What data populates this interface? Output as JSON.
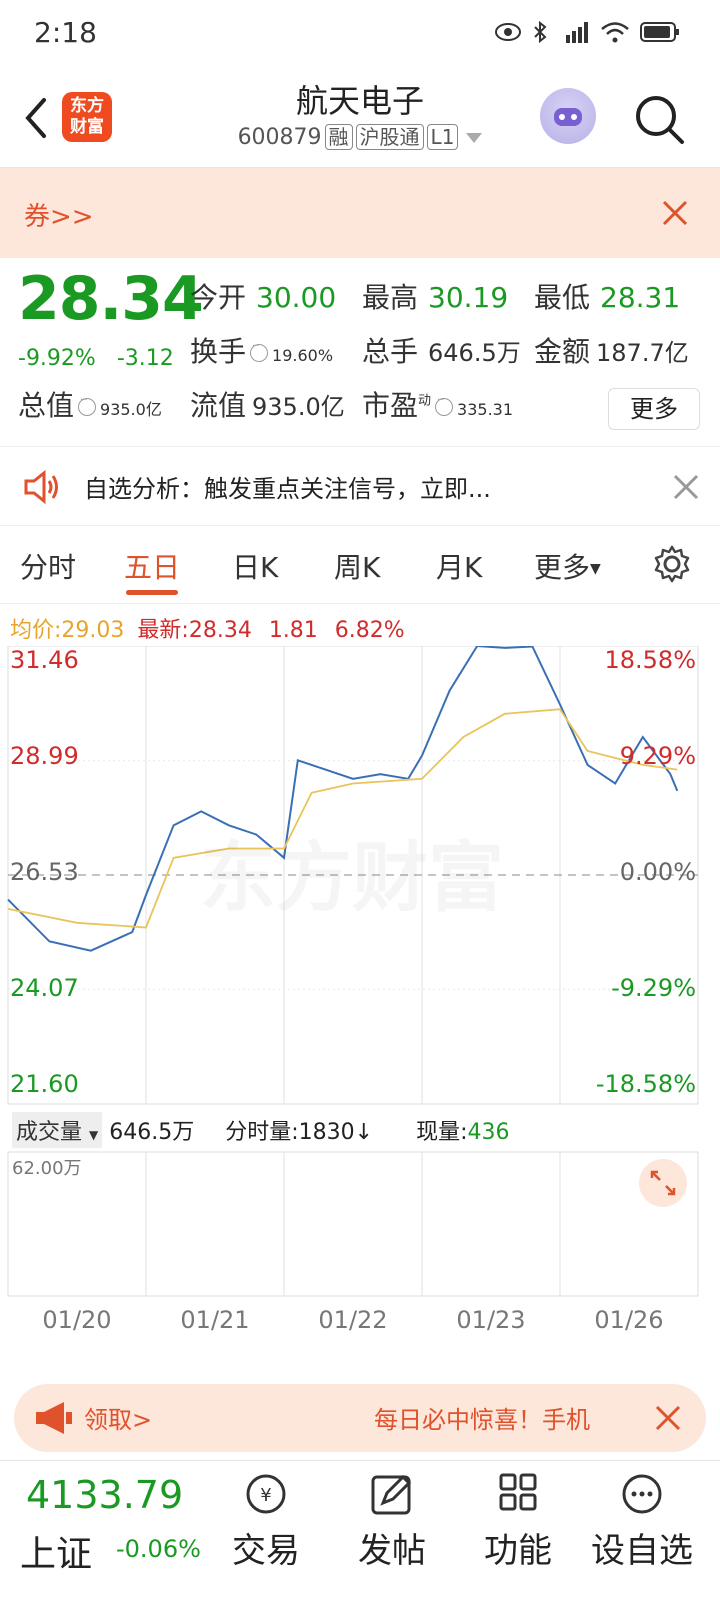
{
  "status": {
    "time": "2:18"
  },
  "header": {
    "title": "航天电子",
    "code": "600879",
    "tags": [
      "融",
      "沪股通",
      "L1"
    ],
    "logo_line1": "东方",
    "logo_line2": "财富"
  },
  "coupon": {
    "text": "券>>"
  },
  "quote": {
    "price": "28.34",
    "pct": "-9.92%",
    "chg": "-3.12",
    "open_label": "今开",
    "open": "30.00",
    "high_label": "最高",
    "high": "30.19",
    "low_label": "最低",
    "low": "28.31",
    "turnover_label": "换手",
    "turnover": "19.60%",
    "vol_label": "总手",
    "vol": "646.5万",
    "amount_label": "金额",
    "amount": "187.7亿",
    "mktcap_label": "总值",
    "mktcap": "935.0亿",
    "float_label": "流值",
    "float": "935.0亿",
    "pe_label": "市盈",
    "pe_sup": "动",
    "pe": "335.31",
    "more": "更多"
  },
  "notice": {
    "text": "自选分析：触发重点关注信号，立即..."
  },
  "tabs": [
    "分时",
    "五日",
    "日K",
    "周K",
    "月K",
    "更多"
  ],
  "avg": {
    "avg_label": "均价:",
    "avg": "29.03",
    "latest_label": "最新:",
    "latest": "28.34",
    "chg": "1.81",
    "pct": "6.82%"
  },
  "chart_data": {
    "type": "line",
    "x": [
      "01/20",
      "01/21",
      "01/22",
      "01/23",
      "01/26"
    ],
    "y_left": [
      "31.46",
      "28.99",
      "26.53",
      "24.07",
      "21.60"
    ],
    "y_right": [
      "18.58%",
      "9.29%",
      "0.00%",
      "-9.29%",
      "-18.58%"
    ],
    "ylim": [
      21.6,
      31.46
    ],
    "prev_close": 26.53,
    "series": [
      {
        "name": "",
        "color": "#3a6fb5",
        "values": [
          [
            0,
            26.0
          ],
          [
            0.3,
            25.1
          ],
          [
            0.6,
            24.9
          ],
          [
            0.9,
            25.3
          ],
          [
            1.0,
            26.1
          ],
          [
            1.2,
            27.6
          ],
          [
            1.4,
            27.9
          ],
          [
            1.6,
            27.6
          ],
          [
            1.8,
            27.4
          ],
          [
            2.0,
            26.9
          ],
          [
            2.1,
            29.0
          ],
          [
            2.3,
            28.8
          ],
          [
            2.5,
            28.6
          ],
          [
            2.7,
            28.7
          ],
          [
            2.9,
            28.6
          ],
          [
            3.0,
            29.1
          ],
          [
            3.2,
            30.5
          ],
          [
            3.4,
            31.46
          ],
          [
            3.6,
            31.42
          ],
          [
            3.8,
            31.45
          ],
          [
            4.0,
            30.2
          ],
          [
            4.2,
            28.9
          ],
          [
            4.4,
            28.5
          ],
          [
            4.6,
            29.5
          ],
          [
            4.8,
            28.7
          ],
          [
            4.85,
            28.34
          ]
        ]
      },
      {
        "name": "",
        "color": "#e8c45a",
        "values": [
          [
            0,
            25.8
          ],
          [
            0.5,
            25.5
          ],
          [
            1.0,
            25.4
          ],
          [
            1.2,
            26.9
          ],
          [
            1.6,
            27.1
          ],
          [
            2.0,
            27.1
          ],
          [
            2.2,
            28.3
          ],
          [
            2.5,
            28.5
          ],
          [
            3.0,
            28.6
          ],
          [
            3.3,
            29.5
          ],
          [
            3.6,
            30.0
          ],
          [
            4.0,
            30.1
          ],
          [
            4.2,
            29.2
          ],
          [
            4.6,
            28.9
          ],
          [
            4.85,
            28.8
          ]
        ]
      }
    ],
    "volume": {
      "label": "成交量",
      "total": "646.5万",
      "tick_label": "分时量:",
      "tick": "1830↓",
      "now_label": "现量:",
      "now": "436",
      "max": "62.00万"
    }
  },
  "banner": {
    "left": "领取>",
    "right": "每日必中惊喜！手机"
  },
  "bottom": {
    "index_value": "4133.79",
    "index_name": "上证",
    "index_chg": "-0.06%",
    "items": [
      "交易",
      "发帖",
      "功能",
      "设自选"
    ]
  }
}
